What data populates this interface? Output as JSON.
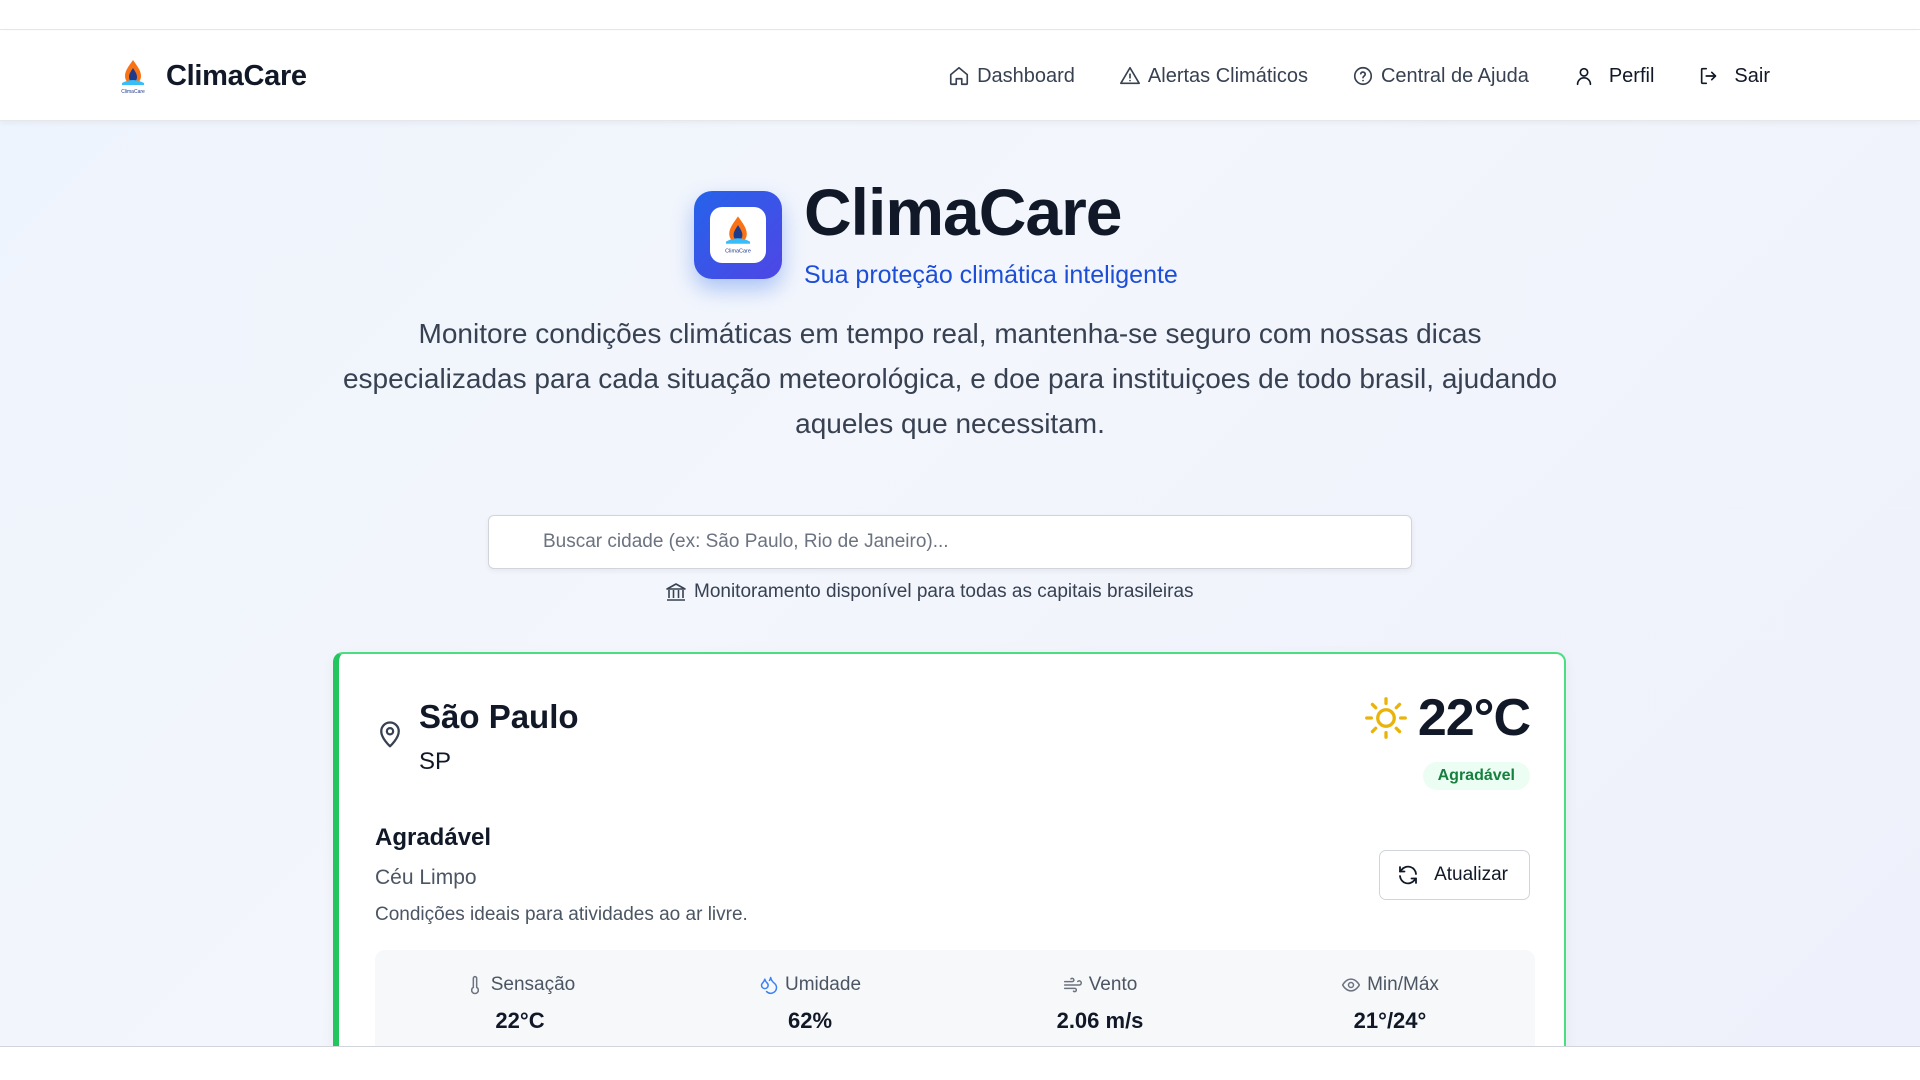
{
  "app": {
    "name": "ClimaCare",
    "logo_text": "ClimaCare"
  },
  "nav": {
    "items": [
      {
        "label": "Dashboard",
        "icon": "home-icon"
      },
      {
        "label": "Alertas Climáticos",
        "icon": "alert-triangle-icon"
      },
      {
        "label": "Central de Ajuda",
        "icon": "help-circle-icon"
      },
      {
        "label": "Perfil",
        "icon": "user-icon"
      },
      {
        "label": "Sair",
        "icon": "logout-icon"
      }
    ]
  },
  "hero": {
    "title": "ClimaCare",
    "subtitle": "Sua proteção climática inteligente",
    "description": "Monitore condições climáticas em tempo real, mantenha-se seguro com nossas dicas especializadas para cada situação meteorológica, e doe para instituiçoes de todo brasil, ajudando aqueles que necessitam."
  },
  "search": {
    "placeholder": "Buscar cidade (ex: São Paulo, Rio de Janeiro)...",
    "value": "",
    "note": "Monitoramento disponível para todas as capitais brasileiras"
  },
  "weather": {
    "city": "São Paulo",
    "state": "SP",
    "temperature": "22°C",
    "badge": "Agradável",
    "condition_title": "Agradável",
    "condition_sub": "Céu Limpo",
    "condition_desc": "Condições ideais para atividades ao ar livre.",
    "refresh_label": "Atualizar",
    "stats": [
      {
        "label": "Sensação",
        "value": "22°C",
        "icon": "thermometer-icon"
      },
      {
        "label": "Umidade",
        "value": "62%",
        "icon": "droplets-icon"
      },
      {
        "label": "Vento",
        "value": "2.06 m/s",
        "icon": "wind-icon"
      },
      {
        "label": "Min/Máx",
        "value": "21°/24°",
        "icon": "eye-icon"
      }
    ]
  },
  "colors": {
    "brand_blue": "#1d4ed8",
    "accent_green": "#22c55e",
    "badge_green_text": "#15803d",
    "sun_yellow": "#eab308"
  }
}
